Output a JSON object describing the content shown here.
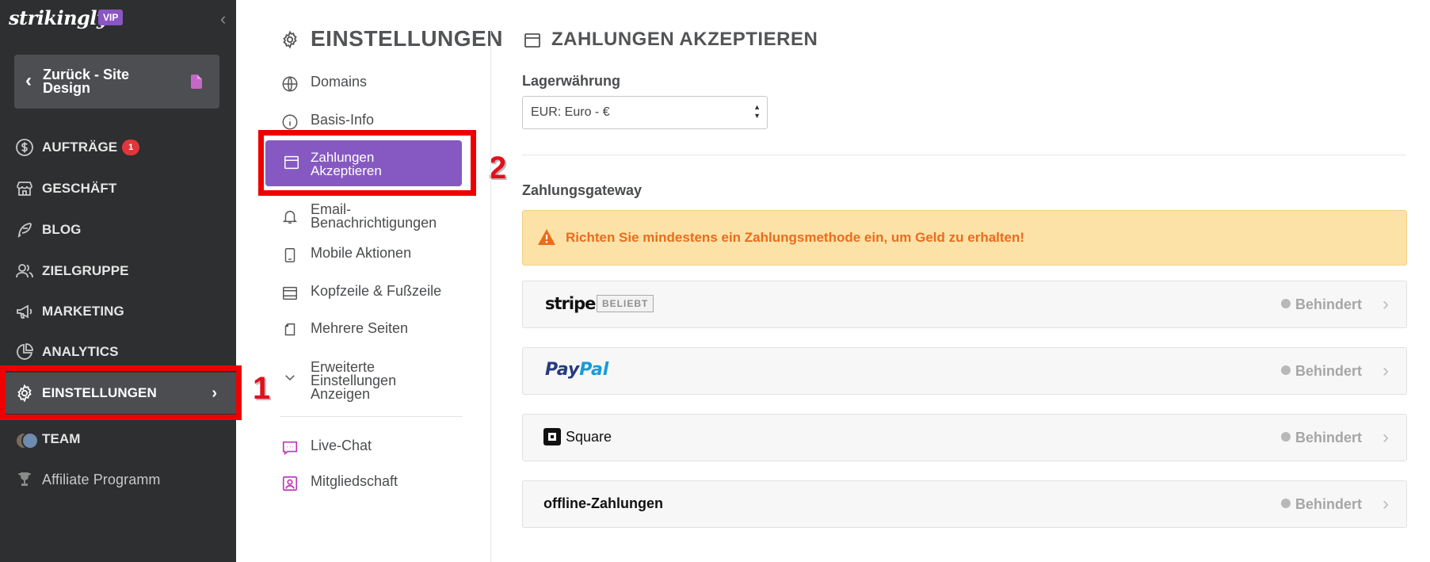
{
  "sidebar": {
    "brand": "strikingly",
    "vip_badge": "VIP",
    "back_button_label": "Zurück - Site Design",
    "items": [
      {
        "label": "AUFTRÄGE",
        "badge": "1"
      },
      {
        "label": "GESCHÄFT"
      },
      {
        "label": "BLOG"
      },
      {
        "label": "ZIELGRUPPE"
      },
      {
        "label": "MARKETING"
      },
      {
        "label": "ANALYTICS"
      },
      {
        "label": "EINSTELLUNGEN"
      },
      {
        "label": "TEAM"
      },
      {
        "label": "Affiliate Programm"
      }
    ]
  },
  "annotations": {
    "marker_1": "1",
    "marker_2": "2"
  },
  "settings_menu": {
    "title": "EINSTELLUNGEN",
    "items": [
      {
        "label": "Domains",
        "icon": "globe-icon"
      },
      {
        "label": "Basis-Info",
        "icon": "info-icon"
      },
      {
        "label": "Zahlungen Akzeptieren",
        "icon": "wallet-icon"
      },
      {
        "label": "Email-Benachrichtigungen",
        "icon": "bell-icon"
      },
      {
        "label": "Mobile Aktionen",
        "icon": "mobile-icon"
      },
      {
        "label": "Kopfzeile & Fußzeile",
        "icon": "header-footer-icon"
      },
      {
        "label": "Mehrere Seiten",
        "icon": "pages-icon"
      },
      {
        "label": "Erweiterte Einstellungen Anzeigen",
        "icon": "chevron-down-icon"
      },
      {
        "label": "Live-Chat",
        "icon": "chat-icon"
      },
      {
        "label": "Mitgliedschaft",
        "icon": "membership-icon"
      }
    ]
  },
  "main": {
    "title": "ZAHLUNGEN AKZEPTIEREN",
    "currency_label": "Lagerwährung",
    "currency_value": "EUR: Euro - €",
    "gateway_label": "Zahlungsgateway",
    "alert_text": "Richten Sie mindestens ein Zahlungsmethode ein, um Geld zu erhalten!",
    "gateways": [
      {
        "name": "stripe",
        "tag": "BELIEBT",
        "status": "Behindert"
      },
      {
        "name_part1": "Pay",
        "name_part2": "Pal",
        "status": "Behindert"
      },
      {
        "name": "Square",
        "status": "Behindert"
      },
      {
        "name": "offline-Zahlungen",
        "status": "Behindert"
      }
    ]
  },
  "colors": {
    "sidebar_bg": "#2e2f30",
    "accent_purple": "#8659c2",
    "alert_bg": "#fde2a8",
    "alert_text": "#ea6c1b",
    "highlight_red": "#ee0000"
  }
}
